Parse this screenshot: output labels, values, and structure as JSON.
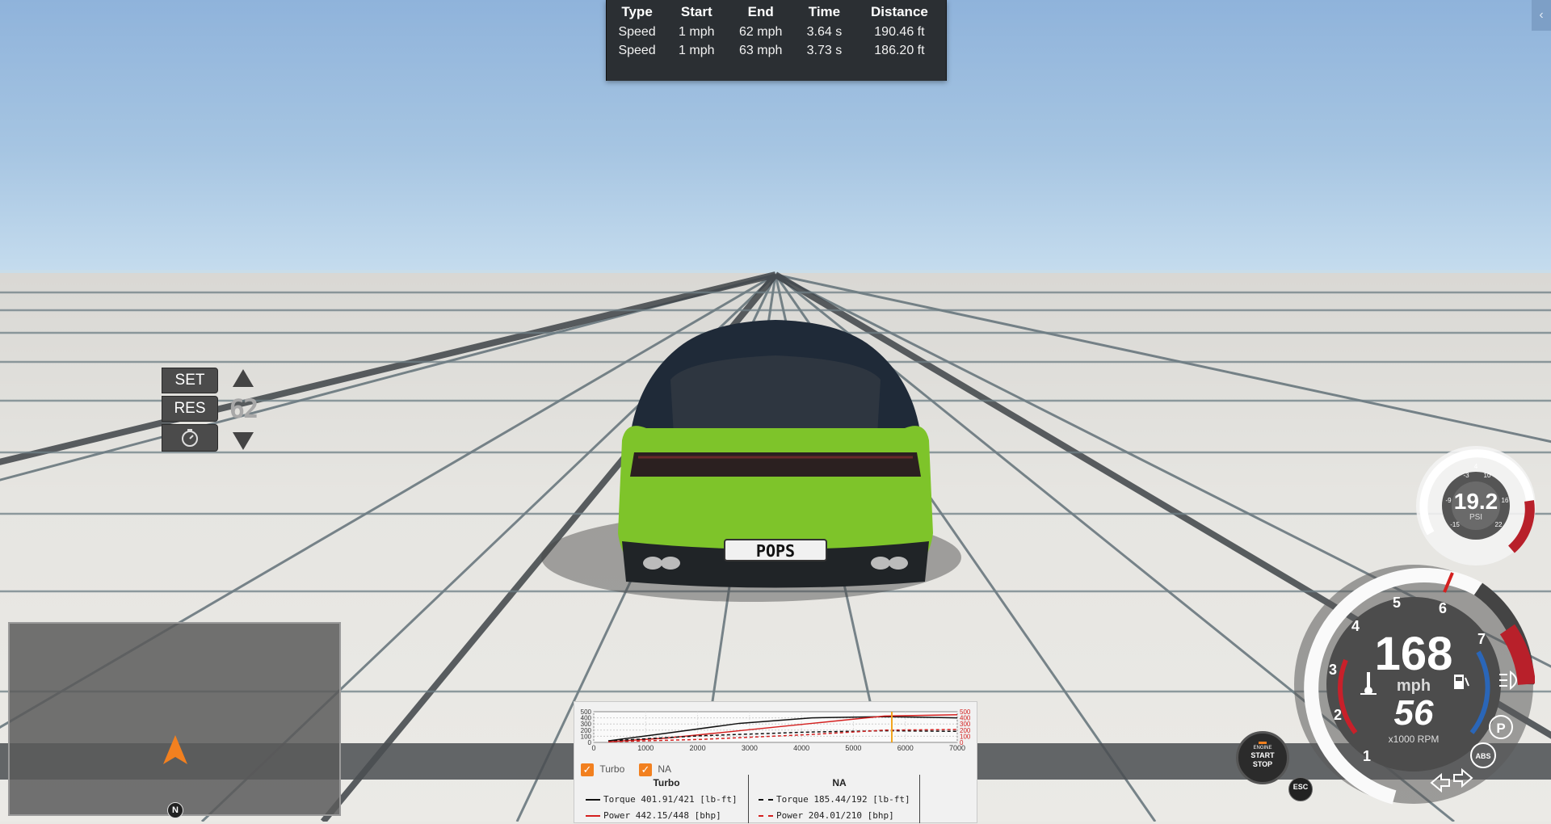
{
  "stats": {
    "headers": [
      "Type",
      "Start",
      "End",
      "Time",
      "Distance"
    ],
    "rows": [
      [
        "Speed",
        "1 mph",
        "62 mph",
        "3.64 s",
        "190.46 ft"
      ],
      [
        "Speed",
        "1 mph",
        "63 mph",
        "3.73 s",
        "186.20 ft"
      ]
    ]
  },
  "cruise": {
    "set_label": "SET",
    "res_label": "RES",
    "timer_icon": "stopwatch-icon",
    "speed": "62"
  },
  "vehicle": {
    "plate": "POPS"
  },
  "minimap": {
    "compass": "N"
  },
  "graph": {
    "x_ticks": [
      "0",
      "1000",
      "2000",
      "3000",
      "4000",
      "5000",
      "6000",
      "7000"
    ],
    "y_ticks": [
      "500",
      "400",
      "300",
      "200",
      "100",
      "0"
    ],
    "legend": {
      "turbo": "Turbo",
      "na": "NA"
    },
    "turbo": {
      "title": "Turbo",
      "torque": "Torque 401.91/421 [lb-ft]",
      "power": "Power  442.15/448 [bhp]"
    },
    "na": {
      "title": "NA",
      "torque": "Torque 185.44/192 [lb-ft]",
      "power": "Power  204.01/210 [bhp]"
    },
    "colors": {
      "torque": "#111111",
      "power": "#d4201f",
      "marker": "#f2a51f"
    }
  },
  "boost_gauge": {
    "value": "19.2",
    "unit": "PSI",
    "ticks": [
      "-3",
      "4",
      "10",
      "-9",
      "16",
      "-15",
      "22"
    ]
  },
  "speedo": {
    "speed": "168",
    "unit": "mph",
    "rpm": "56",
    "rpm_unit": "x1000 RPM",
    "gears": [
      "1",
      "2",
      "3",
      "4",
      "5",
      "6",
      "7"
    ],
    "park": "P",
    "abs": "ABS"
  },
  "engine_button": {
    "top": "ENGINE",
    "line1": "START",
    "line2": "STOP"
  },
  "esc": "ESC",
  "collapse_tab": "‹"
}
